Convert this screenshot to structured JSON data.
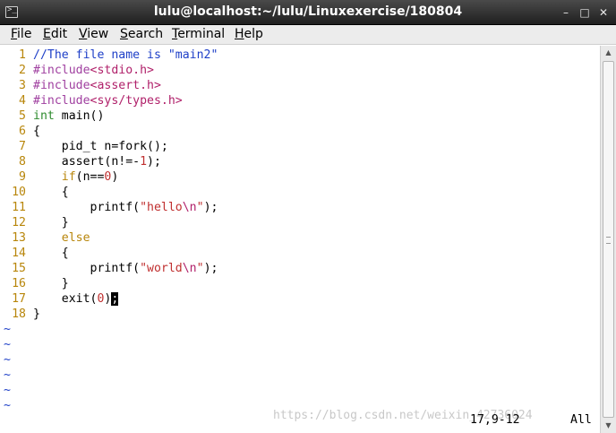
{
  "window": {
    "title": "lulu@localhost:~/lulu/Linuxexercise/180804"
  },
  "menubar": {
    "items": [
      {
        "u": "F",
        "rest": "ile"
      },
      {
        "u": "E",
        "rest": "dit"
      },
      {
        "u": "V",
        "rest": "iew"
      },
      {
        "u": "S",
        "rest": "earch"
      },
      {
        "u": "T",
        "rest": "erminal"
      },
      {
        "u": "H",
        "rest": "elp"
      }
    ]
  },
  "editor": {
    "lines": [
      {
        "n": "1",
        "parts": [
          {
            "t": "//The file name is \"main2\"",
            "c": "c-comment"
          }
        ]
      },
      {
        "n": "2",
        "parts": [
          {
            "t": "#include",
            "c": "c-pre"
          },
          {
            "t": "<stdio.h>",
            "c": "c-inc"
          }
        ]
      },
      {
        "n": "3",
        "parts": [
          {
            "t": "#include",
            "c": "c-pre"
          },
          {
            "t": "<assert.h>",
            "c": "c-inc"
          }
        ]
      },
      {
        "n": "4",
        "parts": [
          {
            "t": "#include",
            "c": "c-pre"
          },
          {
            "t": "<sys/types.h>",
            "c": "c-inc"
          }
        ]
      },
      {
        "n": "5",
        "parts": [
          {
            "t": "int",
            "c": "c-type"
          },
          {
            "t": " main()",
            "c": ""
          }
        ]
      },
      {
        "n": "6",
        "parts": [
          {
            "t": "{",
            "c": ""
          }
        ]
      },
      {
        "n": "7",
        "parts": [
          {
            "t": "    pid_t n=fork();",
            "c": ""
          }
        ]
      },
      {
        "n": "8",
        "parts": [
          {
            "t": "    assert(n!=-",
            "c": ""
          },
          {
            "t": "1",
            "c": "c-num"
          },
          {
            "t": ");",
            "c": ""
          }
        ]
      },
      {
        "n": "9",
        "parts": [
          {
            "t": "    ",
            "c": ""
          },
          {
            "t": "if",
            "c": "c-kw"
          },
          {
            "t": "(n==",
            "c": ""
          },
          {
            "t": "0",
            "c": "c-num"
          },
          {
            "t": ")",
            "c": ""
          }
        ]
      },
      {
        "n": "10",
        "parts": [
          {
            "t": "    {",
            "c": ""
          }
        ]
      },
      {
        "n": "11",
        "parts": [
          {
            "t": "        printf(",
            "c": ""
          },
          {
            "t": "\"hello",
            "c": "c-str"
          },
          {
            "t": "\\n",
            "c": "c-esc"
          },
          {
            "t": "\"",
            "c": "c-str"
          },
          {
            "t": ");",
            "c": ""
          }
        ]
      },
      {
        "n": "12",
        "parts": [
          {
            "t": "    }",
            "c": ""
          }
        ]
      },
      {
        "n": "13",
        "parts": [
          {
            "t": "    ",
            "c": ""
          },
          {
            "t": "else",
            "c": "c-kw"
          }
        ]
      },
      {
        "n": "14",
        "parts": [
          {
            "t": "    {",
            "c": ""
          }
        ]
      },
      {
        "n": "15",
        "parts": [
          {
            "t": "        printf(",
            "c": ""
          },
          {
            "t": "\"world",
            "c": "c-str"
          },
          {
            "t": "\\n",
            "c": "c-esc"
          },
          {
            "t": "\"",
            "c": "c-str"
          },
          {
            "t": ");",
            "c": ""
          }
        ]
      },
      {
        "n": "16",
        "parts": [
          {
            "t": "    }",
            "c": ""
          }
        ]
      },
      {
        "n": "17",
        "parts": [
          {
            "t": "    exit(",
            "c": ""
          },
          {
            "t": "0",
            "c": "c-num"
          },
          {
            "t": ")",
            "c": ""
          },
          {
            "t": ";",
            "c": "cursor"
          }
        ]
      },
      {
        "n": "18",
        "parts": [
          {
            "t": "}",
            "c": ""
          }
        ]
      }
    ],
    "tilde_lines": [
      "~",
      "~",
      "~",
      "~",
      "~",
      "~"
    ]
  },
  "status": {
    "position": "17,9-12",
    "scroll": "All"
  },
  "watermark": "https://blog.csdn.net/weixin_42736024"
}
